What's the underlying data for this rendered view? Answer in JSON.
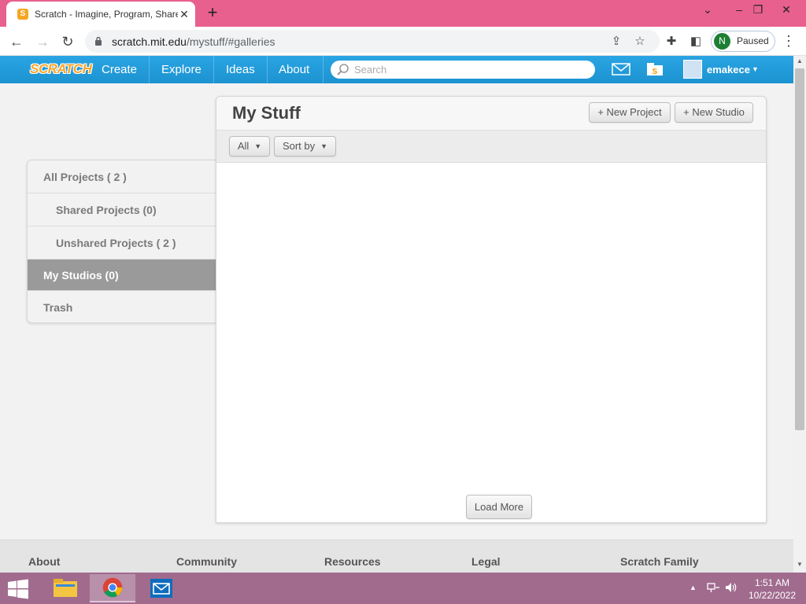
{
  "browser": {
    "tab_title": "Scratch - Imagine, Program, Share",
    "favicon_letter": "S",
    "url_host": "scratch.mit.edu",
    "url_path": "/mystuff/#galleries",
    "profile_initial": "N",
    "profile_status": "Paused"
  },
  "scratch_nav": {
    "logo": "SCRATCH",
    "links": [
      "Create",
      "Explore",
      "Ideas",
      "About"
    ],
    "search_placeholder": "Search",
    "username": "emakece"
  },
  "mystuff": {
    "title": "My Stuff",
    "new_project": "+ New Project",
    "new_studio": "+ New Studio",
    "filter_all": "All",
    "sort_by": "Sort by",
    "load_more": "Load More"
  },
  "sidebar": {
    "items": [
      {
        "label": "All Projects ( 2 )"
      },
      {
        "label": "Shared Projects (0)"
      },
      {
        "label": "Unshared Projects ( 2 )"
      },
      {
        "label": "My Studios (0)",
        "active": true
      },
      {
        "label": "Trash"
      }
    ]
  },
  "footer": {
    "columns": [
      "About",
      "Community",
      "Resources",
      "Legal",
      "Scratch Family"
    ]
  },
  "taskbar": {
    "time": "1:51 AM",
    "date": "10/22/2022"
  },
  "colors": {
    "browser_frame": "#e8608e",
    "scratch_blue": "#1d93d1",
    "active_item": "#9a9a9a",
    "taskbar": "#a16b8e"
  }
}
